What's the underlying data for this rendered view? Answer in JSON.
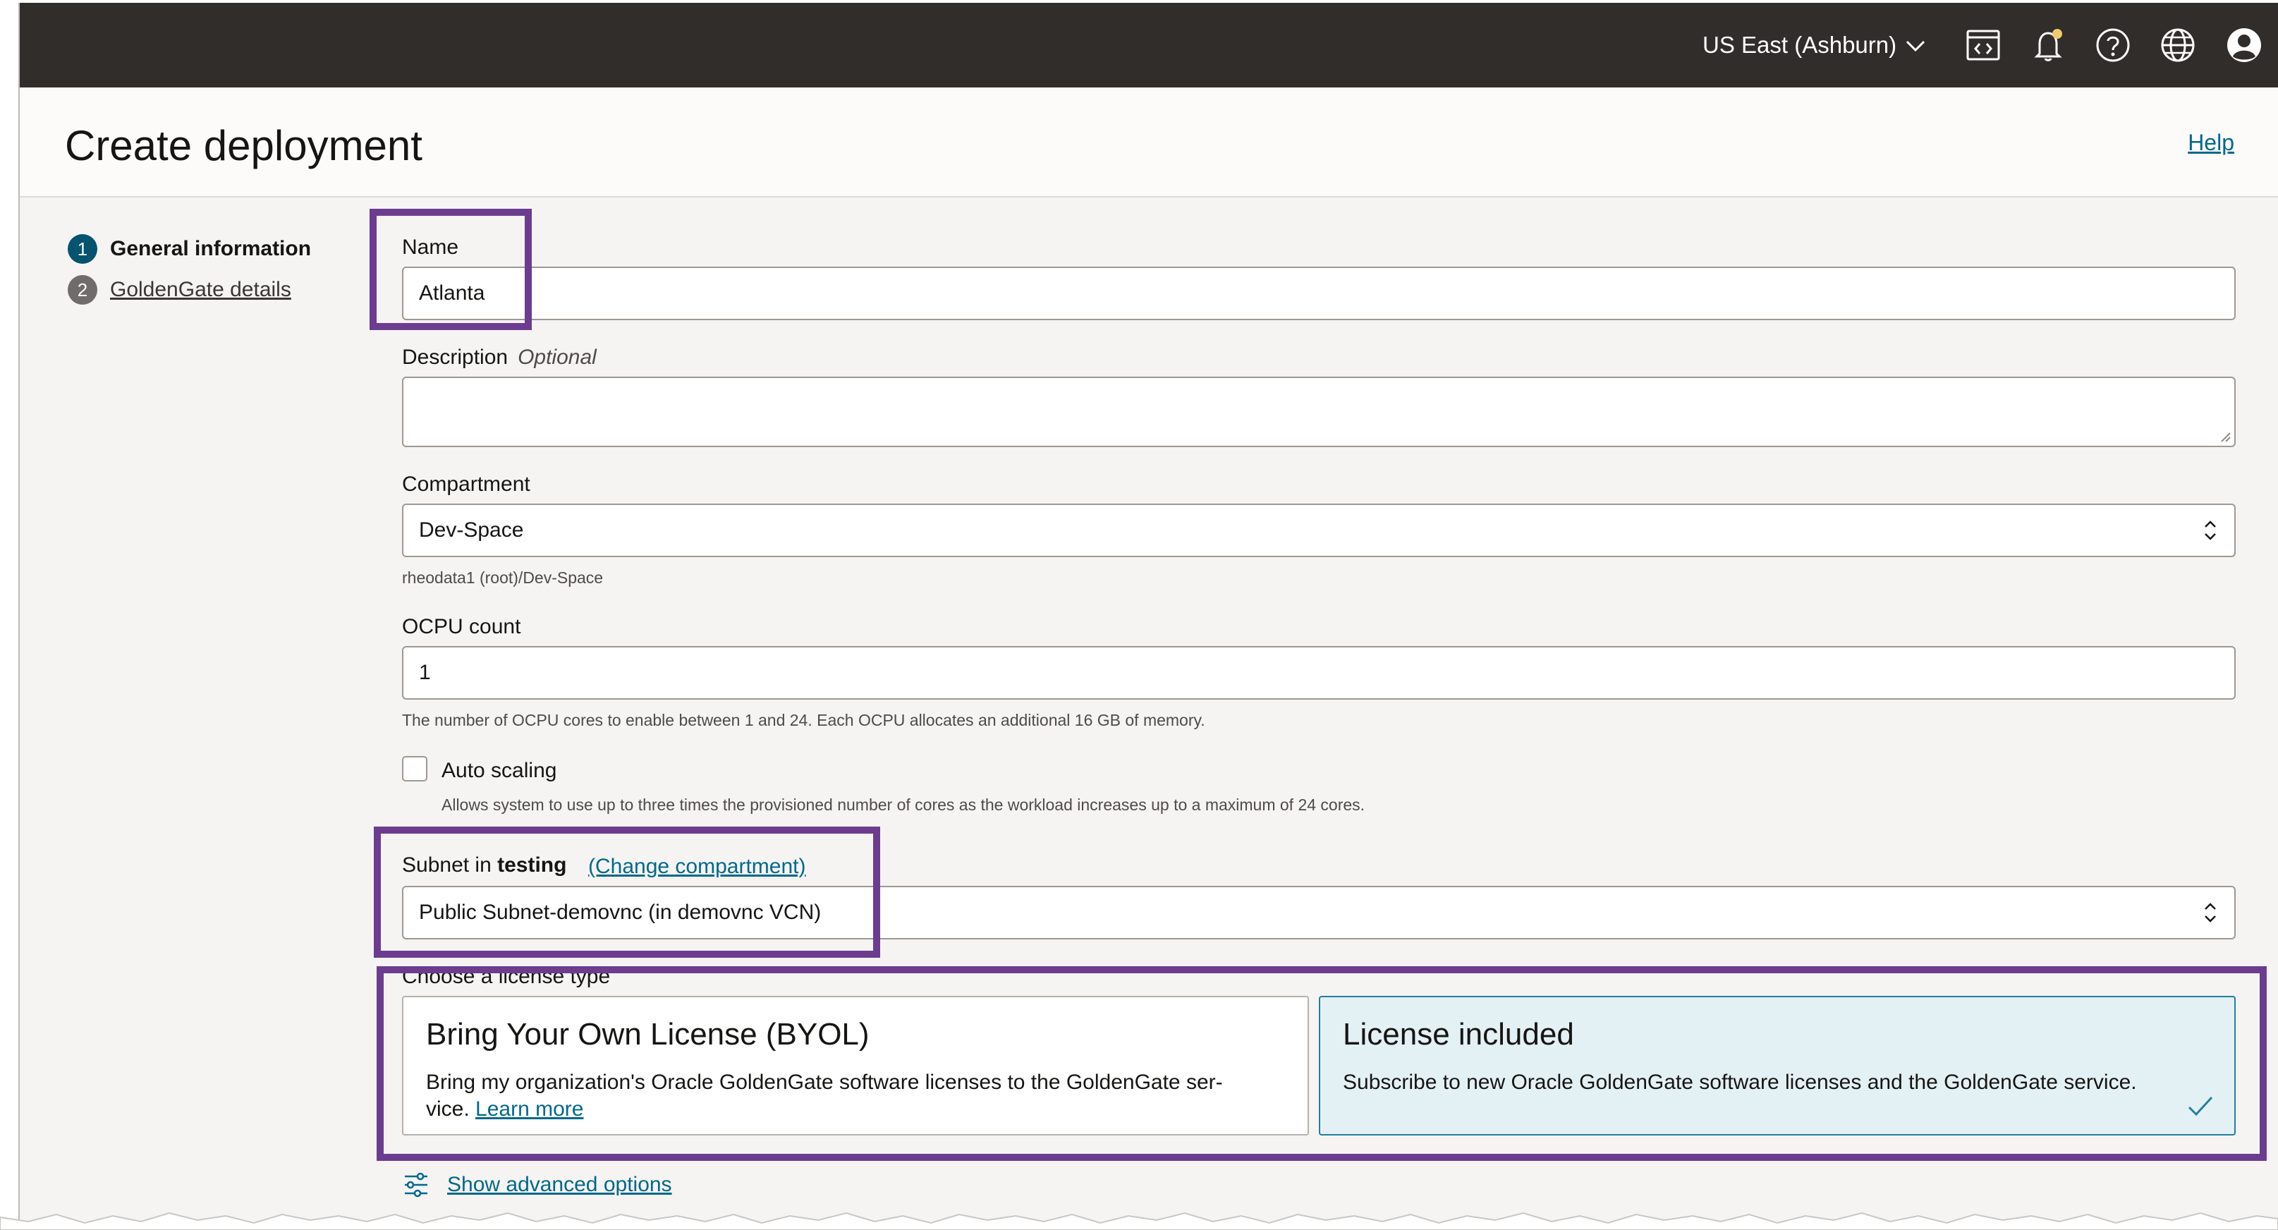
{
  "topbar": {
    "region": "US East (Ashburn)",
    "icons": [
      "developer-tools-icon",
      "notifications-icon",
      "help-icon",
      "language-icon",
      "user-avatar-icon"
    ]
  },
  "header": {
    "title": "Create deployment",
    "help_label": "Help"
  },
  "steps": [
    {
      "number": "1",
      "label": "General information"
    },
    {
      "number": "2",
      "label": "GoldenGate details"
    }
  ],
  "form": {
    "name": {
      "label": "Name",
      "value": "Atlanta"
    },
    "description": {
      "label": "Description",
      "optional": "Optional",
      "value": ""
    },
    "compartment": {
      "label": "Compartment",
      "value": "Dev-Space",
      "hint": "rheodata1 (root)/Dev-Space"
    },
    "ocpu": {
      "label": "OCPU count",
      "value": "1",
      "hint": "The number of OCPU cores to enable between 1 and 24. Each OCPU allocates an additional 16 GB of memory."
    },
    "auto_scaling": {
      "label": "Auto scaling",
      "checked": false,
      "hint": "Allows system to use up to three times the provisioned number of cores as the workload increases up to a maximum of 24 cores."
    },
    "subnet": {
      "label_prefix": "Subnet in",
      "label_compartment": "testing",
      "change_link": "(Change compartment)",
      "value": "Public Subnet-demovnc (in demovnc VCN)"
    },
    "license": {
      "label": "Choose a license type",
      "byol": {
        "title": "Bring Your Own License (BYOL)",
        "desc_line1": "Bring my organization's Oracle GoldenGate software licenses to the GoldenGate ser-",
        "desc_line2": "vice.",
        "learn_more": "Learn more"
      },
      "included": {
        "title": "License included",
        "desc": "Subscribe to new Oracle GoldenGate software licenses and the GoldenGate service.",
        "selected": true
      }
    },
    "advanced_label": "Show advanced options"
  },
  "colors": {
    "topbar": "#312d2a",
    "link": "#00688c",
    "callout": "#6b3c8f",
    "selected_card": "#e4f1f4"
  }
}
